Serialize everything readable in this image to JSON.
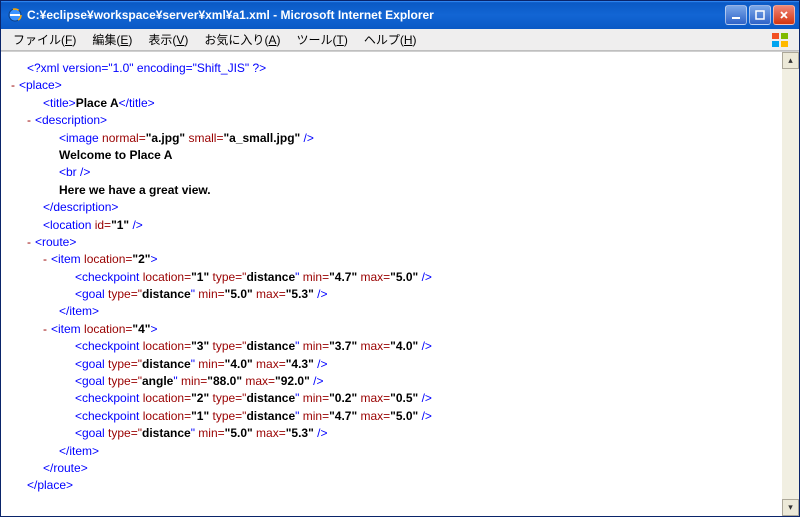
{
  "window": {
    "title": "C:¥eclipse¥workspace¥server¥xml¥a1.xml - Microsoft Internet Explorer"
  },
  "menu": {
    "file": {
      "label": "ファイル",
      "key": "F"
    },
    "edit": {
      "label": "編集",
      "key": "E"
    },
    "view": {
      "label": "表示",
      "key": "V"
    },
    "fav": {
      "label": "お気に入り",
      "key": "A"
    },
    "tools": {
      "label": "ツール",
      "key": "T"
    },
    "help": {
      "label": "ヘルプ",
      "key": "H"
    }
  },
  "glyph": {
    "minus": "-",
    "scroll_up": "▴",
    "scroll_down": "▾"
  },
  "xml": {
    "prolog": "<?xml version=\"1.0\" encoding=\"Shift_JIS\" ?>",
    "place_open": "<place>",
    "place_close": "</place>",
    "title_open": "<title>",
    "title_text": "Place A",
    "title_close": "</title>",
    "desc_open": "<description>",
    "desc_close": "</description>",
    "image": {
      "open": "<image",
      "a1n": " normal=",
      "a1v": "\"a.jpg\"",
      "a2n": " small=",
      "a2v": "\"a_small.jpg\"",
      "close": " />"
    },
    "welcome": "Welcome to Place A",
    "br": "<br />",
    "here": "Here we have a great view.",
    "location": {
      "open": "<location",
      "idn": " id=",
      "idv": "\"1\"",
      "close": " />"
    },
    "route_open": "<route>",
    "route_close": "</route>",
    "item2": {
      "open": "<item",
      "locn": " location=",
      "locv": "\"2\"",
      "close": ">",
      "end": "</item>",
      "cp": {
        "open": "<checkpoint",
        "locn": " location=",
        "locv": "\"1\"",
        "typn": " type=\"",
        "typv": "distance",
        "typc": "\"",
        "minn": " min=",
        "minv": "\"4.7\"",
        "maxn": " max=",
        "maxv": "\"5.0\"",
        "close": " />"
      },
      "goal": {
        "open": "<goal",
        "typn": " type=\"",
        "typv": "distance",
        "typc": "\"",
        "minn": " min=",
        "minv": "\"5.0\"",
        "maxn": " max=",
        "maxv": "\"5.3\"",
        "close": " />"
      }
    },
    "item4": {
      "open": "<item",
      "locn": " location=",
      "locv": "\"4\"",
      "close": ">",
      "end": "</item>",
      "cp3": {
        "open": "<checkpoint",
        "locn": " location=",
        "locv": "\"3\"",
        "typn": " type=\"",
        "typv": "distance",
        "typc": "\"",
        "minn": " min=",
        "minv": "\"3.7\"",
        "maxn": " max=",
        "maxv": "\"4.0\"",
        "close": " />"
      },
      "g1": {
        "open": "<goal",
        "typn": " type=\"",
        "typv": "distance",
        "typc": "\"",
        "minn": " min=",
        "minv": "\"4.0\"",
        "maxn": " max=",
        "maxv": "\"4.3\"",
        "close": " />"
      },
      "g2": {
        "open": "<goal",
        "typn": " type=\"",
        "typv": "angle",
        "typc": "\"",
        "minn": " min=",
        "minv": "\"88.0\"",
        "maxn": " max=",
        "maxv": "\"92.0\"",
        "close": " />"
      },
      "cp2": {
        "open": "<checkpoint",
        "locn": " location=",
        "locv": "\"2\"",
        "typn": " type=\"",
        "typv": "distance",
        "typc": "\"",
        "minn": " min=",
        "minv": "\"0.2\"",
        "maxn": " max=",
        "maxv": "\"0.5\"",
        "close": " />"
      },
      "cp1": {
        "open": "<checkpoint",
        "locn": " location=",
        "locv": "\"1\"",
        "typn": " type=\"",
        "typv": "distance",
        "typc": "\"",
        "minn": " min=",
        "minv": "\"4.7\"",
        "maxn": " max=",
        "maxv": "\"5.0\"",
        "close": " />"
      },
      "g3": {
        "open": "<goal",
        "typn": " type=\"",
        "typv": "distance",
        "typc": "\"",
        "minn": " min=",
        "minv": "\"5.0\"",
        "maxn": " max=",
        "maxv": "\"5.3\"",
        "close": " />"
      }
    }
  }
}
